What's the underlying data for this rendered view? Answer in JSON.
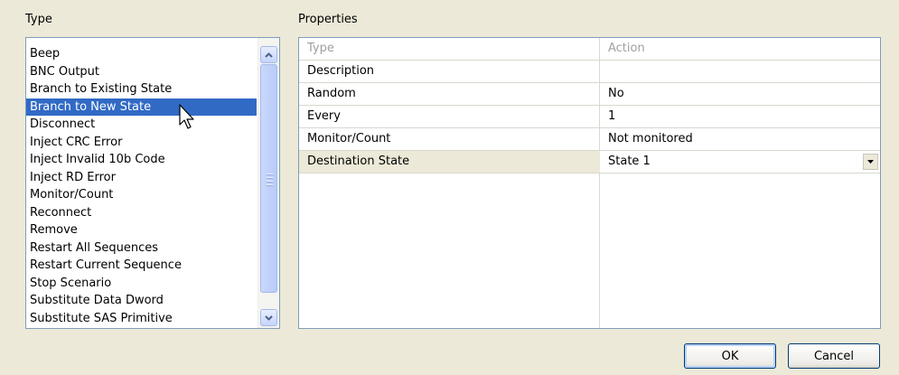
{
  "labels": {
    "type": "Type",
    "properties": "Properties"
  },
  "type_list": {
    "items": [
      "Beep",
      "BNC Output",
      "Branch to Existing State",
      "Branch to New State",
      "Disconnect",
      "Inject CRC Error",
      "Inject Invalid 10b Code",
      "Inject RD Error",
      "Monitor/Count",
      "Reconnect",
      "Remove",
      "Restart All Sequences",
      "Restart Current Sequence",
      "Stop Scenario",
      "Substitute Data Dword",
      "Substitute SAS Primitive"
    ],
    "selected": "Branch to New State"
  },
  "properties": {
    "header": {
      "name": "Type",
      "value": "Action"
    },
    "rows": [
      {
        "name": "Description",
        "value": ""
      },
      {
        "name": "Random",
        "value": "No"
      },
      {
        "name": "Every",
        "value": "1"
      },
      {
        "name": "Monitor/Count",
        "value": "Not monitored"
      },
      {
        "name": "Destination State",
        "value": "State 1"
      }
    ]
  },
  "buttons": {
    "ok": "OK",
    "cancel": "Cancel"
  },
  "icons": {
    "scroll_up": "arrow-up-icon",
    "scroll_down": "arrow-down-icon",
    "dropdown": "chevron-down-icon",
    "cursor": "mouse-pointer-icon"
  }
}
